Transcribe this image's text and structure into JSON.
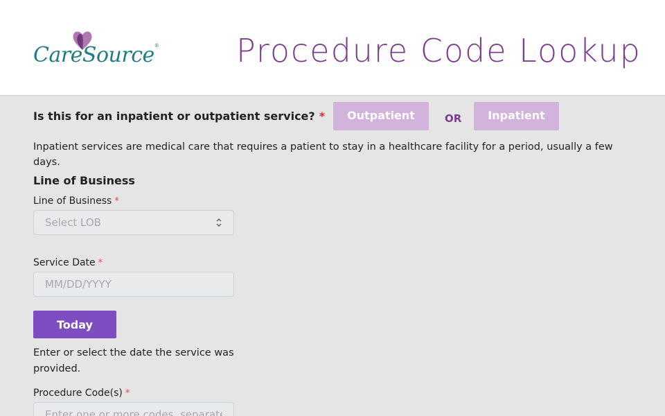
{
  "header": {
    "logo_text": "CareSource",
    "logo_reg": "®",
    "title": "Procedure Code Lookup"
  },
  "service_type": {
    "question": "Is this for an inpatient or outpatient service?",
    "required_mark": "*",
    "outpatient_label": "Outpatient",
    "or_label": "OR",
    "inpatient_label": "Inpatient",
    "help": "Inpatient services are medical care that requires a patient to stay in a healthcare facility for a period, usually a few days."
  },
  "line_of_business": {
    "section_title": "Line of Business",
    "label": "Line of Business",
    "required_mark": "*",
    "placeholder": "Select LOB"
  },
  "service_date": {
    "label": "Service Date",
    "required_mark": "*",
    "placeholder": "MM/DD/YYYY",
    "today_label": "Today",
    "help": "Enter or select the date the service was provided."
  },
  "procedure_codes": {
    "label": "Procedure Code(s)",
    "required_mark": "*",
    "placeholder": "Enter one or more codes, separated by commas"
  },
  "colors": {
    "brand_purple": "#7b3e8c",
    "brand_teal": "#1e7c85",
    "button_light_purple": "#d1b3dc",
    "today_button": "#7e4dc0",
    "required_red": "#d32f2f"
  },
  "icons": {
    "logo": "heart-logo-icon",
    "select": "select-arrows-icon"
  }
}
